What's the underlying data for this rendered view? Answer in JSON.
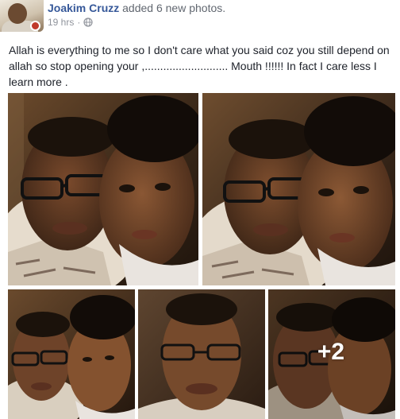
{
  "post": {
    "author_name": "Joakim Cruzz",
    "action_text": "added 6 new photos.",
    "timestamp": "19 hrs",
    "separator": "·",
    "privacy_icon": "globe-icon",
    "text": "Allah is everything to me so I don't care what you said coz you still depend on allah so stop opening your ,........................... Mouth !!!!!! In fact I care less I learn more ."
  },
  "photos": {
    "more_count_label": "+2",
    "items": [
      {
        "name": "photo-1"
      },
      {
        "name": "photo-2"
      },
      {
        "name": "photo-3"
      },
      {
        "name": "photo-4"
      },
      {
        "name": "photo-5"
      }
    ]
  },
  "colors": {
    "author_link": "#365899",
    "meta_text": "#90949c",
    "body_text": "#1d2129"
  }
}
